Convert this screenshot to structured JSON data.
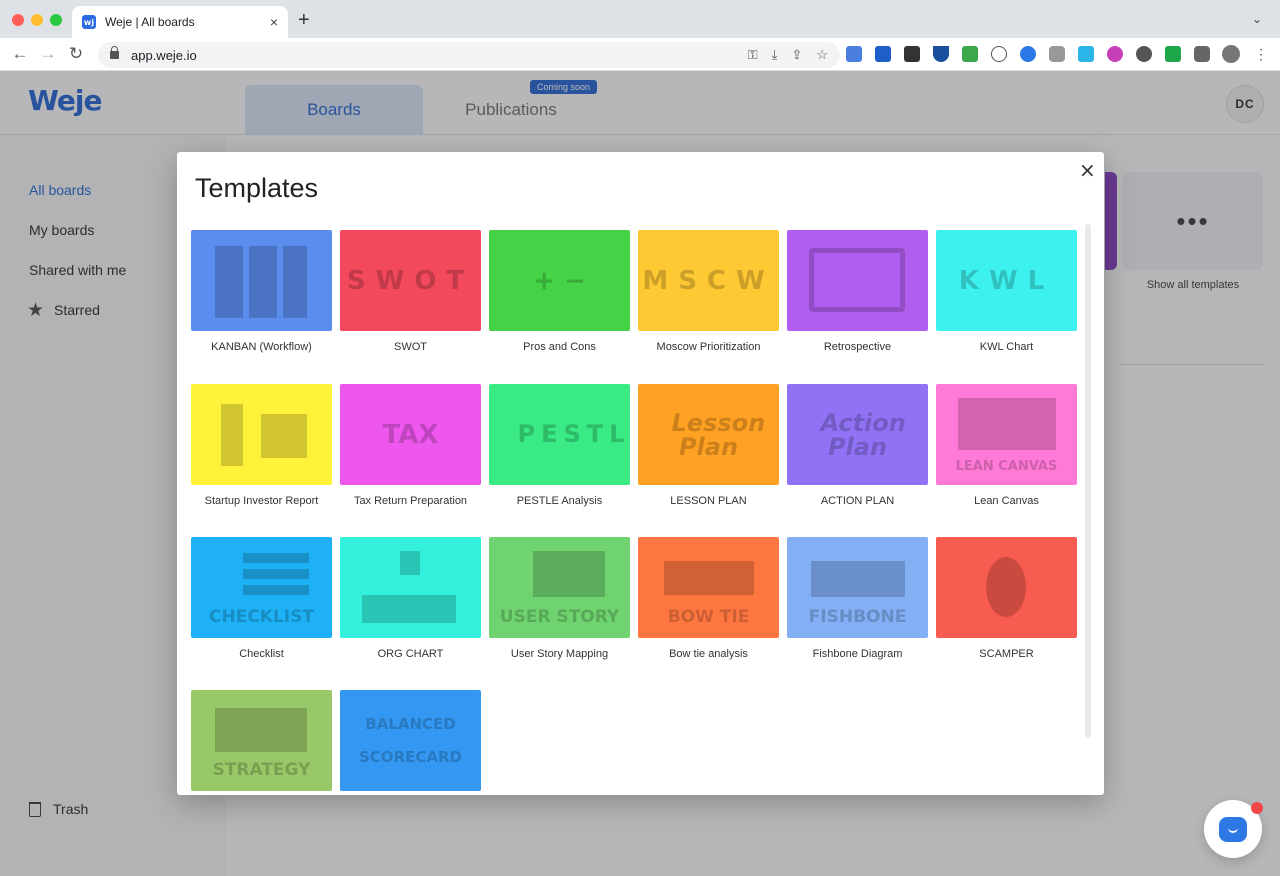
{
  "browser": {
    "tab_title": "Weje | All boards",
    "favicon": "wj",
    "url": "app.weje.io",
    "new_tab": "+",
    "tab_close": "×",
    "tab_menu": "⌄"
  },
  "app": {
    "logo": "Weje",
    "tabs": {
      "boards": "Boards",
      "publications": "Publications"
    },
    "coming_soon": "Coming soon",
    "avatar": "DC"
  },
  "sidebar": {
    "items": [
      {
        "label": "All boards",
        "active": true
      },
      {
        "label": "My boards"
      },
      {
        "label": "Shared with me"
      },
      {
        "label": "Starred",
        "icon": "star-icon"
      }
    ],
    "trash": "Trash"
  },
  "main": {
    "more_glyph": "•••",
    "show_all": "Show all templates"
  },
  "modal": {
    "title": "Templates",
    "close": "×",
    "templates": [
      {
        "label": "KANBAN (Workflow)",
        "color": "#5b8def",
        "art": "kanban"
      },
      {
        "label": "SWOT",
        "color": "#f2495c",
        "art": "SWOT"
      },
      {
        "label": "Pros and Cons",
        "color": "#46d246",
        "art": "+ −"
      },
      {
        "label": "Moscow Prioritization",
        "color": "#ffc933",
        "art": "MSCW"
      },
      {
        "label": "Retrospective",
        "color": "#b05ef0",
        "art": "retro"
      },
      {
        "label": "KWL Chart",
        "color": "#3df2ee",
        "art": "KWL"
      },
      {
        "label": "Startup Investor Report",
        "color": "#fff23a",
        "art": "rocket"
      },
      {
        "label": "Tax Return Preparation",
        "color": "#ee57ee",
        "art": "TAX"
      },
      {
        "label": "PESTLE Analysis",
        "color": "#39ea85",
        "art": "PESTLE"
      },
      {
        "label": "LESSON PLAN",
        "color": "#ffa123",
        "art": "Lesson Plan"
      },
      {
        "label": "ACTION PLAN",
        "color": "#9072f5",
        "art": "Action Plan"
      },
      {
        "label": "Lean Canvas",
        "color": "#ff79d6",
        "art": "LEAN CANVAS"
      },
      {
        "label": "Checklist",
        "color": "#1fb1f5",
        "art": "CHECKLIST"
      },
      {
        "label": "ORG CHART",
        "color": "#33f0dc",
        "art": "org"
      },
      {
        "label": "User Story Mapping",
        "color": "#6fd370",
        "art": "USER STORY"
      },
      {
        "label": "Bow tie analysis",
        "color": "#ff7740",
        "art": "BOW TIE"
      },
      {
        "label": "Fishbone Diagram",
        "color": "#83aff5",
        "art": "FISHBONE"
      },
      {
        "label": "SCAMPER",
        "color": "#f85b4f",
        "art": "scamper"
      },
      {
        "label": "",
        "color": "#98c867",
        "art": "STRATEGY"
      },
      {
        "label": "",
        "color": "#3498f2",
        "art": "BALANCED SCORECARD"
      }
    ]
  }
}
